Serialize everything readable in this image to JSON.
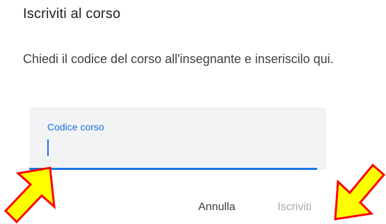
{
  "dialog": {
    "title": "Iscriviti al corso",
    "description": "Chiedi il codice del corso all'insegnante e inseriscilo qui.",
    "field": {
      "label": "Codice corso",
      "value": ""
    },
    "actions": {
      "cancel_label": "Annulla",
      "submit_label": "Iscriviti"
    }
  },
  "annotations": {
    "arrow_color": "#ffff00",
    "arrow_outline": "#ff0000"
  },
  "colors": {
    "accent": "#1a73e8",
    "field_bg": "#f1f3f4",
    "disabled_text": "#a6abb1"
  }
}
